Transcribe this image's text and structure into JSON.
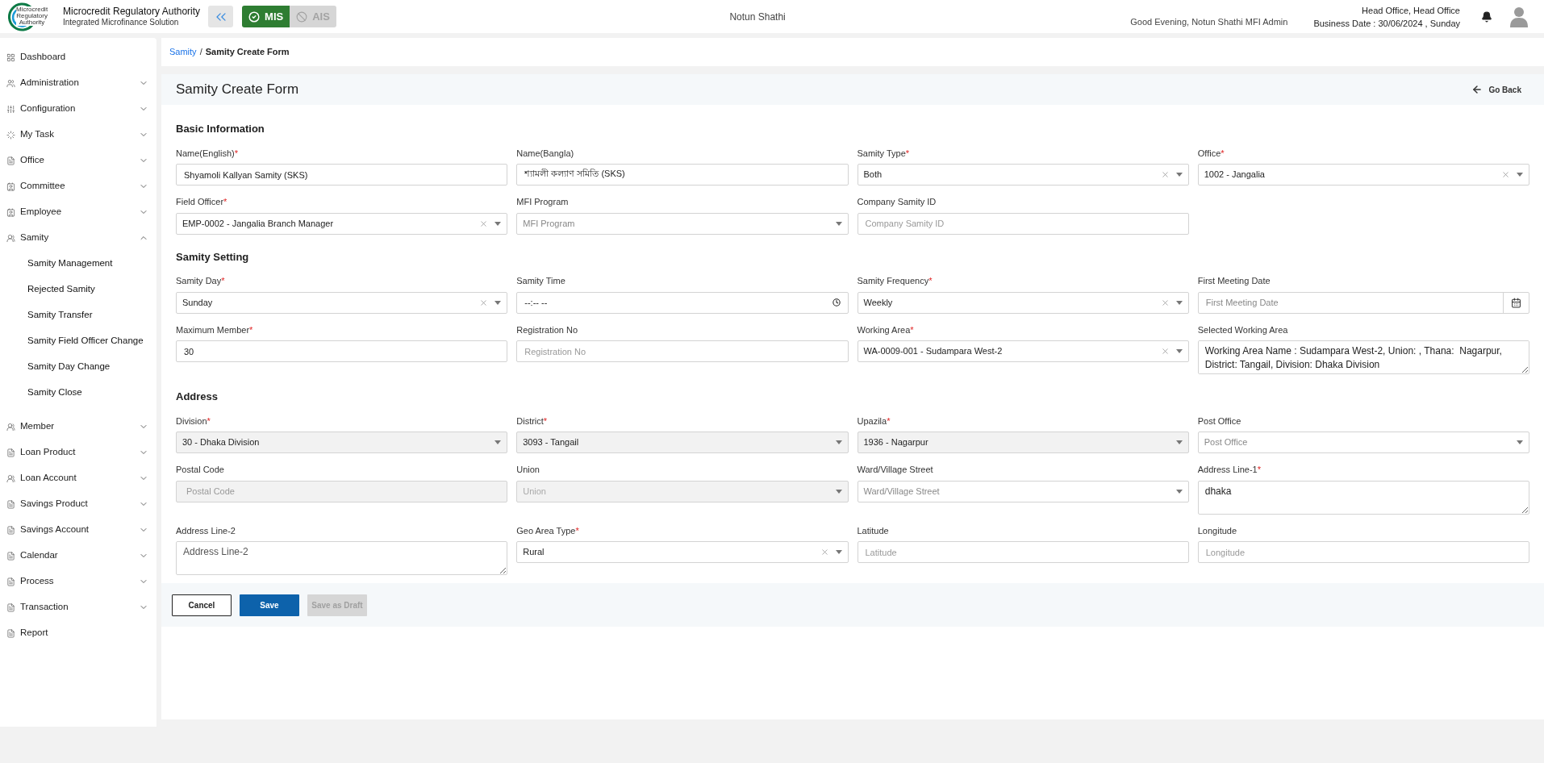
{
  "header": {
    "logo_text": [
      "Microcredit",
      "Regulatory",
      "Authority"
    ],
    "org_name": "Microcredit Regulatory Authority",
    "org_subtitle": "Integrated Microfinance Solution",
    "modes": [
      {
        "label": "MIS",
        "selected": true
      },
      {
        "label": "AIS",
        "selected": false
      }
    ],
    "center_title": "Notun Shathi",
    "greeting": "Good Evening, Notun Shathi MFI Admin",
    "office": "Head Office, Head Office",
    "business_date": "Business Date : 30/06/2024 , Sunday"
  },
  "sidebar": {
    "items": [
      {
        "label": "Dashboard",
        "kind": "link"
      },
      {
        "label": "Administration",
        "kind": "group",
        "expanded": false
      },
      {
        "label": "Configuration",
        "kind": "group",
        "expanded": false
      },
      {
        "label": "My Task",
        "kind": "group",
        "expanded": false
      },
      {
        "label": "Office",
        "kind": "group",
        "expanded": false
      },
      {
        "label": "Committee",
        "kind": "group",
        "expanded": false
      },
      {
        "label": "Employee",
        "kind": "group",
        "expanded": false
      },
      {
        "label": "Samity",
        "kind": "group",
        "expanded": true,
        "children": [
          {
            "label": "Samity Management"
          },
          {
            "label": "Rejected Samity"
          },
          {
            "label": "Samity Transfer"
          },
          {
            "label": "Samity Field Officer Change"
          },
          {
            "label": "Samity Day Change"
          },
          {
            "label": "Samity Close"
          }
        ]
      },
      {
        "label": "Member",
        "kind": "group",
        "expanded": false
      },
      {
        "label": "Loan Product",
        "kind": "group",
        "expanded": false
      },
      {
        "label": "Loan Account",
        "kind": "group",
        "expanded": false
      },
      {
        "label": "Savings Product",
        "kind": "group",
        "expanded": false
      },
      {
        "label": "Savings Account",
        "kind": "group",
        "expanded": false
      },
      {
        "label": "Calendar",
        "kind": "group",
        "expanded": false
      },
      {
        "label": "Process",
        "kind": "group",
        "expanded": false
      },
      {
        "label": "Transaction",
        "kind": "group",
        "expanded": false
      },
      {
        "label": "Report",
        "kind": "link"
      }
    ]
  },
  "breadcrumb": [
    {
      "label": "Samity",
      "kind": "link"
    },
    {
      "label": "/",
      "kind": "separator"
    },
    {
      "label": "Samity Create Form",
      "kind": "current"
    }
  ],
  "form": {
    "title": "Samity Create Form",
    "back_label": "Go Back",
    "sections": [
      {
        "title": "Basic Information",
        "fields": [
          {
            "label": "Name(English)",
            "required_mark": "*",
            "kind": "text",
            "value": "Shyamoli Kallyan Samity (SKS)"
          },
          {
            "label": "Name(Bangla)",
            "kind": "text",
            "value": "শ্যামলী কল্যাণ সমিতি (SKS)"
          },
          {
            "label": "Samity Type",
            "required_mark": "*",
            "kind": "select",
            "value": "Both",
            "clearable": true
          },
          {
            "label": "Office",
            "required_mark": "*",
            "kind": "select",
            "value": "1002 - Jangalia",
            "clearable": true
          },
          {
            "label": "Field Officer",
            "required_mark": "*",
            "kind": "select",
            "value": "EMP-0002 - Jangalia Branch Manager",
            "clearable": true
          },
          {
            "label": "MFI Program",
            "kind": "select",
            "placeholder": "MFI Program"
          },
          {
            "label": "Company Samity ID",
            "kind": "text",
            "placeholder": "Company Samity ID"
          }
        ]
      },
      {
        "title": "Samity Setting",
        "fields": [
          {
            "label": "Samity Day",
            "required_mark": "*",
            "kind": "select",
            "value": "Sunday",
            "clearable": true
          },
          {
            "label": "Samity Time",
            "kind": "time",
            "value": "--:-- --"
          },
          {
            "label": "Samity Frequency",
            "required_mark": "*",
            "kind": "select",
            "value": "Weekly",
            "clearable": true
          },
          {
            "label": "First Meeting Date",
            "kind": "date",
            "placeholder": "First Meeting Date"
          },
          {
            "label": "Maximum Member",
            "required_mark": "*",
            "kind": "text",
            "value": "30"
          },
          {
            "label": "Registration No",
            "kind": "text",
            "placeholder": "Registration No"
          },
          {
            "label": "Working Area",
            "required_mark": "*",
            "kind": "select",
            "value": "WA-0009-001 - Sudampara West-2",
            "clearable": true
          },
          {
            "label": "Selected Working Area",
            "kind": "textarea",
            "value": "Working Area Name : Sudampara West-2, Union: , Thana:  Nagarpur, District: Tangail, Division: Dhaka Division"
          }
        ]
      },
      {
        "title": "Address",
        "fields": [
          {
            "label": "Division",
            "required_mark": "*",
            "kind": "select",
            "value": "30 - Dhaka Division",
            "disabled": true
          },
          {
            "label": "District",
            "required_mark": "*",
            "kind": "select",
            "value": "3093 - Tangail",
            "disabled": true
          },
          {
            "label": "Upazila",
            "required_mark": "*",
            "kind": "select",
            "value": "1936 - Nagarpur",
            "disabled": true
          },
          {
            "label": "Post Office",
            "kind": "select",
            "placeholder": "Post Office"
          },
          {
            "label": "Postal Code",
            "kind": "text",
            "placeholder": "Postal Code",
            "disabled": true
          },
          {
            "label": "Union",
            "kind": "select",
            "placeholder": "Union",
            "disabled": true
          },
          {
            "label": "Ward/Village Street",
            "kind": "select",
            "placeholder": "Ward/Village Street"
          },
          {
            "label": "Address Line-1",
            "required_mark": "*",
            "kind": "textarea",
            "value": "dhaka"
          },
          {
            "label": "Address Line-2",
            "kind": "textarea",
            "placeholder": "Address Line-2"
          },
          {
            "label": "Geo Area Type",
            "required_mark": "*",
            "kind": "select",
            "value": "Rural",
            "clearable": true
          },
          {
            "label": "Latitude",
            "kind": "text",
            "placeholder": "Latitude"
          },
          {
            "label": "Longitude",
            "kind": "text",
            "placeholder": "Longitude"
          }
        ]
      }
    ],
    "buttons": [
      {
        "label": "Cancel",
        "kind": "outline"
      },
      {
        "label": "Save",
        "kind": "primary"
      },
      {
        "label": "Save as Draft",
        "kind": "primary",
        "disabled": true
      }
    ]
  }
}
